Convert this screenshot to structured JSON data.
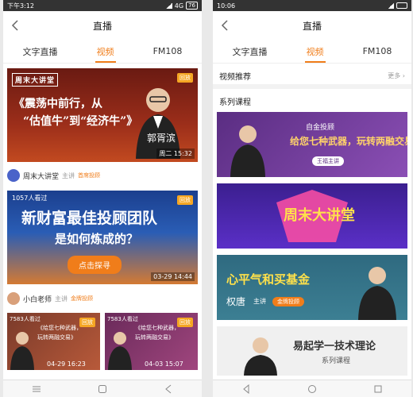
{
  "left": {
    "status": {
      "time": "下午3:12",
      "network": "4G",
      "battery": "76"
    },
    "title": "直播",
    "tabs": [
      "文字直播",
      "视频",
      "FM108"
    ],
    "cards": [
      {
        "logo": "周末大讲堂",
        "line1": "《震荡中前行，从",
        "line2": "“估值牛”到“经济牛”》",
        "name": "郭胥滨",
        "tag": "回放",
        "time": "周二 15:32"
      },
      {
        "views": "1057人看过",
        "line1": "新财富最佳投顾团队",
        "line2": "是如何炼成的？",
        "button": "点击探寻",
        "tag": "回放",
        "time": "03-29 14:44"
      }
    ],
    "authors": [
      {
        "name": "周末大讲堂",
        "role": "主讲",
        "badge": "首席投顾"
      },
      {
        "name": "小白老师",
        "role": "主讲",
        "badge": "金牌投顾"
      }
    ],
    "small_cards": [
      {
        "views": "7583人看过",
        "tag": "回放",
        "text1": "《给您七种武器，",
        "text2": "玩转两融交易》",
        "time": "04-29 16:23"
      },
      {
        "views": "7583人看过",
        "tag": "回放",
        "text1": "《给您七种武器，",
        "text2": "玩转两融交易》",
        "time": "04-03 15:07"
      }
    ]
  },
  "right": {
    "status": {
      "time": "10:06"
    },
    "title": "直播",
    "tabs": [
      "文字直播",
      "视频",
      "FM108"
    ],
    "recommend": "视频推荐",
    "more": "更多",
    "series": "系列课程",
    "banners": [
      {
        "small": "自金投顾",
        "main": "给您七种武器，玩转两融交易",
        "tag": "王福主讲"
      },
      {
        "main": "周末大讲堂"
      },
      {
        "main": "心平气和买基金",
        "name": "权唐",
        "role": "主讲",
        "badge": "金牌投顾"
      },
      {
        "main": "易起学一技术理论",
        "sub": "系列课程"
      }
    ]
  }
}
